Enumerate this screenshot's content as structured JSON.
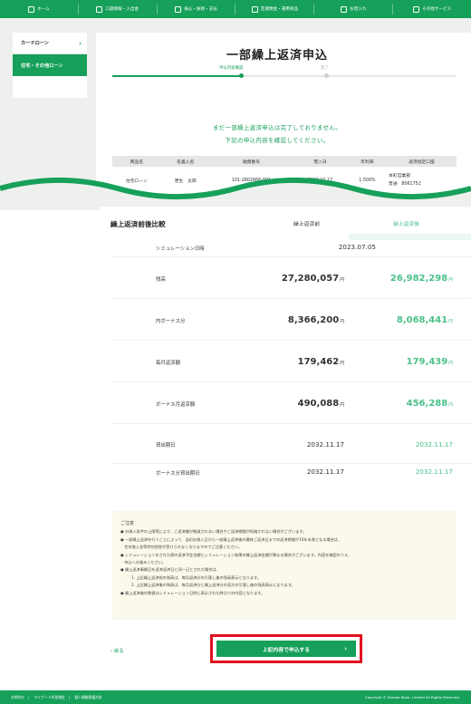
{
  "nav": [
    {
      "label": "ホーム",
      "icon": "home-icon"
    },
    {
      "label": "口座情報・入出金",
      "icon": "account-icon"
    },
    {
      "label": "振込・振替・支払",
      "icon": "transfer-icon"
    },
    {
      "label": "定期預金・運用商品",
      "icon": "deposit-icon"
    },
    {
      "label": "お借入れ",
      "icon": "loan-icon"
    },
    {
      "label": "その他サービス",
      "icon": "services-icon"
    }
  ],
  "sidebar": {
    "items": [
      {
        "label": "カードローン"
      },
      {
        "label": "住宅・その他ローン"
      }
    ]
  },
  "page": {
    "title": "一部繰上返済申込",
    "steps": [
      "申込内容確認",
      "完了"
    ]
  },
  "notice": {
    "line1": "まだ一部繰上返済申込は完了しておりません。",
    "line2": "下記の申込内容を確認してください。"
  },
  "loan_table": {
    "headers": [
      "商品名",
      "名義人名",
      "融資番号",
      "借入日",
      "年利率",
      "返済指定口座"
    ],
    "row": {
      "product": "住宅ローン",
      "holder": "更生　太郎",
      "loan_no": "101-2802668-001",
      "date": "2032.11.17",
      "rate": "1.500%",
      "branch": "本町営業部",
      "account": "普通　8061752"
    }
  },
  "compare": {
    "title": "繰上返済前後比較",
    "col_before": "繰上返済前",
    "col_after": "繰上返済後",
    "unit": "円",
    "sim_label": "シミュレーション日時",
    "sim_value": "2023.07.05",
    "rows": [
      {
        "label": "残高",
        "before": "27,280,057",
        "after": "26,982,298"
      },
      {
        "label": "内ボーナス分",
        "before": "8,366,200",
        "after": "8,068,441"
      },
      {
        "label": "毎月返済額",
        "before": "179,462",
        "after": "179,439"
      },
      {
        "label": "ボーナス月返済額",
        "before": "490,088",
        "after": "456,288"
      },
      {
        "label": "貸出期日",
        "before": "2032.11.17",
        "after": "2032.11.17"
      },
      {
        "label": "ボーナス分貸出期日",
        "before": "2032.11.17",
        "after": "2032.11.17"
      }
    ]
  },
  "caution": {
    "title": "ご注意",
    "lines": [
      "● お借入条件の上限等により、ご返済額が軽減されない場合やご返済期間が短縮されない場合がございます。",
      "● 一部繰上返済を行うことによって、当初お借入日から一部繰上返済後の最終ご返済日までの返済期間が10年未満となる場合は、",
      "　住宅借入金等特別控除が受けられなくなりますのでご注意ください。",
      "● シミュレーションをされた際の返済予定金額とシミュレーション結果の繰上返済金額が異なる場合がございます。内容を確認のうえ、",
      "　申込へお進みください。",
      "● 繰上返済事繰日を返済返済日と同一日とされた場合は、",
      "1. 上記繰上返済前の残高は、毎月返済分の引落し後の残高表示となります。",
      "2. 上記繰上返済後の残高は、毎月返済分と繰上返済分の双方の引落し後の残高表示となります。",
      "● 繰上返済後の数値はシミュレーション日時に表示された時点での内容となります。"
    ]
  },
  "actions": {
    "back": "戻る",
    "submit": "上記内容で申込する"
  },
  "footer": {
    "links": [
      "お問合せ",
      "マイゲート利用規定",
      "個人情報保護方針"
    ],
    "copyright": "Copyright © Seesee Bank, Limited All Rights Reserved."
  },
  "colors": {
    "brand": "#16a05a",
    "after_value": "#4cc18a",
    "highlight": "#e2101e"
  }
}
